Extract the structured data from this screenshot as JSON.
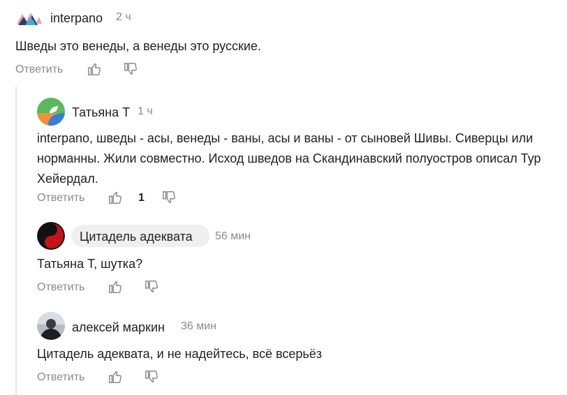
{
  "comments": [
    {
      "author": "interpano",
      "time": "2 ч",
      "text": "Шведы это венеды, а венеды это русские.",
      "reply_label": "Ответить",
      "avatar_icon": "mountain-logo-icon"
    },
    {
      "author": "Татьяна Т",
      "time": "1 ч",
      "text": "interpano, шведы - асы, венеды - ваны, асы и ваны - от сыновей Шивы. Сиверцы или норманны. Жили совместно. Исход шведов на Скандинавский полуостров описал Тур Хейердал.",
      "reply_label": "Ответить",
      "likes": "1",
      "avatar_icon": "leaf-avatar-icon"
    },
    {
      "author": "Цитадель адеквата",
      "time": "56 мин",
      "text": "Татьяна Т, шутка?",
      "reply_label": "Ответить",
      "avatar_icon": "yin-yang-icon"
    },
    {
      "author": "алексей маркин",
      "time": "36 мин",
      "text": "Цитадель адеквата, и не надейтесь, всё всерьёз",
      "reply_label": "Ответить",
      "avatar_icon": "user-photo-icon"
    }
  ],
  "colors": {
    "muted": "#8a8a8a",
    "thread_line": "#e6e6e6",
    "badge_bg": "#efefef"
  }
}
